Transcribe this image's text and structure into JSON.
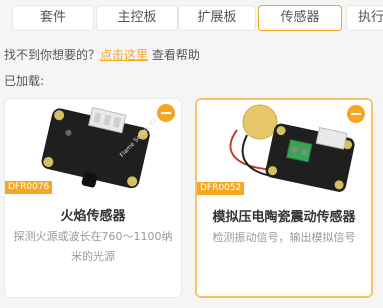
{
  "tabs": [
    {
      "label": "套件"
    },
    {
      "label": "主控板"
    },
    {
      "label": "扩展板"
    },
    {
      "label": "传感器"
    },
    {
      "label": "执行"
    }
  ],
  "hint": {
    "prefix": "找不到你想要的？",
    "link": "点击这里",
    "suffix": " 查看帮助"
  },
  "loaded_label": "已加载:",
  "cards": [
    {
      "sku": "DFR0076",
      "title": "火焰传感器",
      "desc": "探测火源或波长在760～1100纳米的光源",
      "board_label": "Flame Sensor V2"
    },
    {
      "sku": "DFR0052",
      "title": "模拟压电陶瓷震动传感器",
      "desc": "检测振动信号，输出模拟信号"
    }
  ],
  "colors": {
    "accent": "#f5a623",
    "board": "#1f1f1f",
    "piezo": "#e8c66a"
  }
}
